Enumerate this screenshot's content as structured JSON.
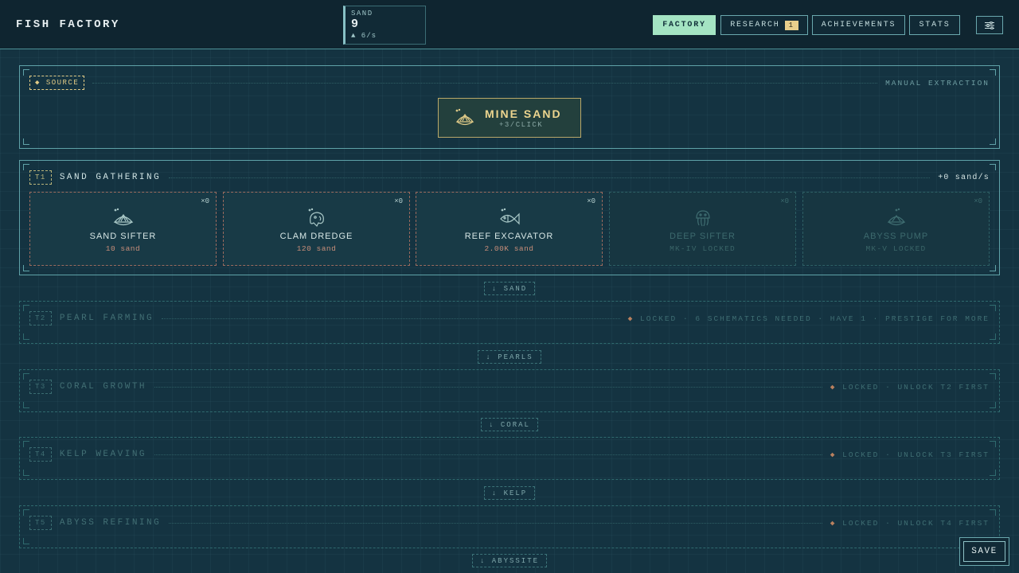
{
  "app": {
    "title": "FISH FACTORY"
  },
  "resource": {
    "name": "SAND",
    "value": "9",
    "rate": "▲ 6/s"
  },
  "nav": [
    {
      "label": "FACTORY",
      "active": true
    },
    {
      "label": "RESEARCH",
      "badge": "1"
    },
    {
      "label": "ACHIEVEMENTS"
    },
    {
      "label": "STATS"
    }
  ],
  "settings": {
    "icon": "sliders-icon"
  },
  "source": {
    "tag": "◆ SOURCE",
    "right": "MANUAL EXTRACTION",
    "button": {
      "label": "MINE SAND",
      "sub": "+3/CLICK",
      "icon": "shell-icon"
    }
  },
  "tier1": {
    "tag": "T1",
    "title": "SAND GATHERING",
    "rate": "+0 sand/s",
    "cards": [
      {
        "name": "SAND SIFTER",
        "cost": "10 sand",
        "count": "×0",
        "icon": "shell-icon",
        "locked": false
      },
      {
        "name": "CLAM DREDGE",
        "cost": "120 sand",
        "count": "×0",
        "icon": "clam-icon",
        "locked": false
      },
      {
        "name": "REEF EXCAVATOR",
        "cost": "2.00K sand",
        "count": "×0",
        "icon": "fish-icon",
        "locked": false
      },
      {
        "name": "DEEP SIFTER",
        "cost": "MK-IV LOCKED",
        "count": "×0",
        "icon": "jellyfish-icon",
        "locked": true
      },
      {
        "name": "ABYSS PUMP",
        "cost": "MK-V LOCKED",
        "count": "×0",
        "icon": "shell-icon",
        "locked": true
      }
    ]
  },
  "connectors": [
    "↓ SAND",
    "↓ PEARLS",
    "↓ CORAL",
    "↓ KELP",
    "↓ ABYSSITE"
  ],
  "locked_tiers": [
    {
      "tag": "T2",
      "title": "PEARL FARMING",
      "status_marker": "◆",
      "status": "LOCKED · 6 SCHEMATICS NEEDED · HAVE 1 · PRESTIGE FOR MORE"
    },
    {
      "tag": "T3",
      "title": "CORAL GROWTH",
      "status_marker": "◆",
      "status": "LOCKED · UNLOCK T2 FIRST"
    },
    {
      "tag": "T4",
      "title": "KELP WEAVING",
      "status_marker": "◆",
      "status": "LOCKED · UNLOCK T3 FIRST"
    },
    {
      "tag": "T5",
      "title": "ABYSS REFINING",
      "status_marker": "◆",
      "status": "LOCKED · UNLOCK T4 FIRST"
    }
  ],
  "save": {
    "label": "SAVE"
  }
}
